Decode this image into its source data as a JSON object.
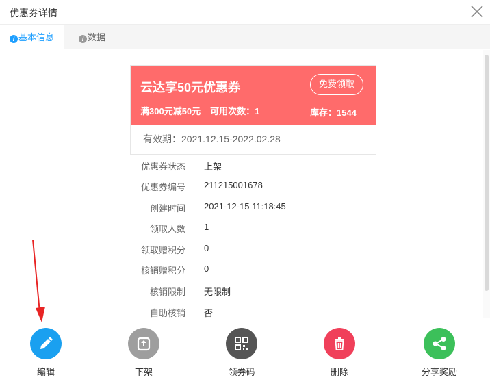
{
  "dialog": {
    "title": "优惠券详情"
  },
  "tabs": [
    {
      "label": "基本信息",
      "active": true
    },
    {
      "label": "数据",
      "active": false
    }
  ],
  "coupon": {
    "name": "云达享50元优惠券",
    "condition": "满300元减50元",
    "usage": "可用次数：1",
    "claim_button": "免费领取",
    "stock": "库存：1544",
    "validity": "有效期：2021.12.15-2022.02.28",
    "card_color": "#ff6b6b"
  },
  "details": [
    {
      "label": "优惠券状态",
      "value": "上架"
    },
    {
      "label": "优惠券编号",
      "value": "211215001678"
    },
    {
      "label": "创建时间",
      "value": "2021-12-15 11:18:45"
    },
    {
      "label": "领取人数",
      "value": "1"
    },
    {
      "label": "领取赠积分",
      "value": "0"
    },
    {
      "label": "核销赠积分",
      "value": "0"
    },
    {
      "label": "核销限制",
      "value": "无限制"
    },
    {
      "label": "自助核销",
      "value": "否"
    }
  ],
  "actions": [
    {
      "label": "编辑",
      "icon": "pencil-icon",
      "color": "#1aa0f0"
    },
    {
      "label": "下架",
      "icon": "unshelve-icon",
      "color": "#9e9e9e"
    },
    {
      "label": "领券码",
      "icon": "qr-code-icon",
      "color": "#555555"
    },
    {
      "label": "删除",
      "icon": "trash-icon",
      "color": "#f0405a"
    },
    {
      "label": "分享奖励",
      "icon": "share-icon",
      "color": "#3cc05a"
    }
  ]
}
